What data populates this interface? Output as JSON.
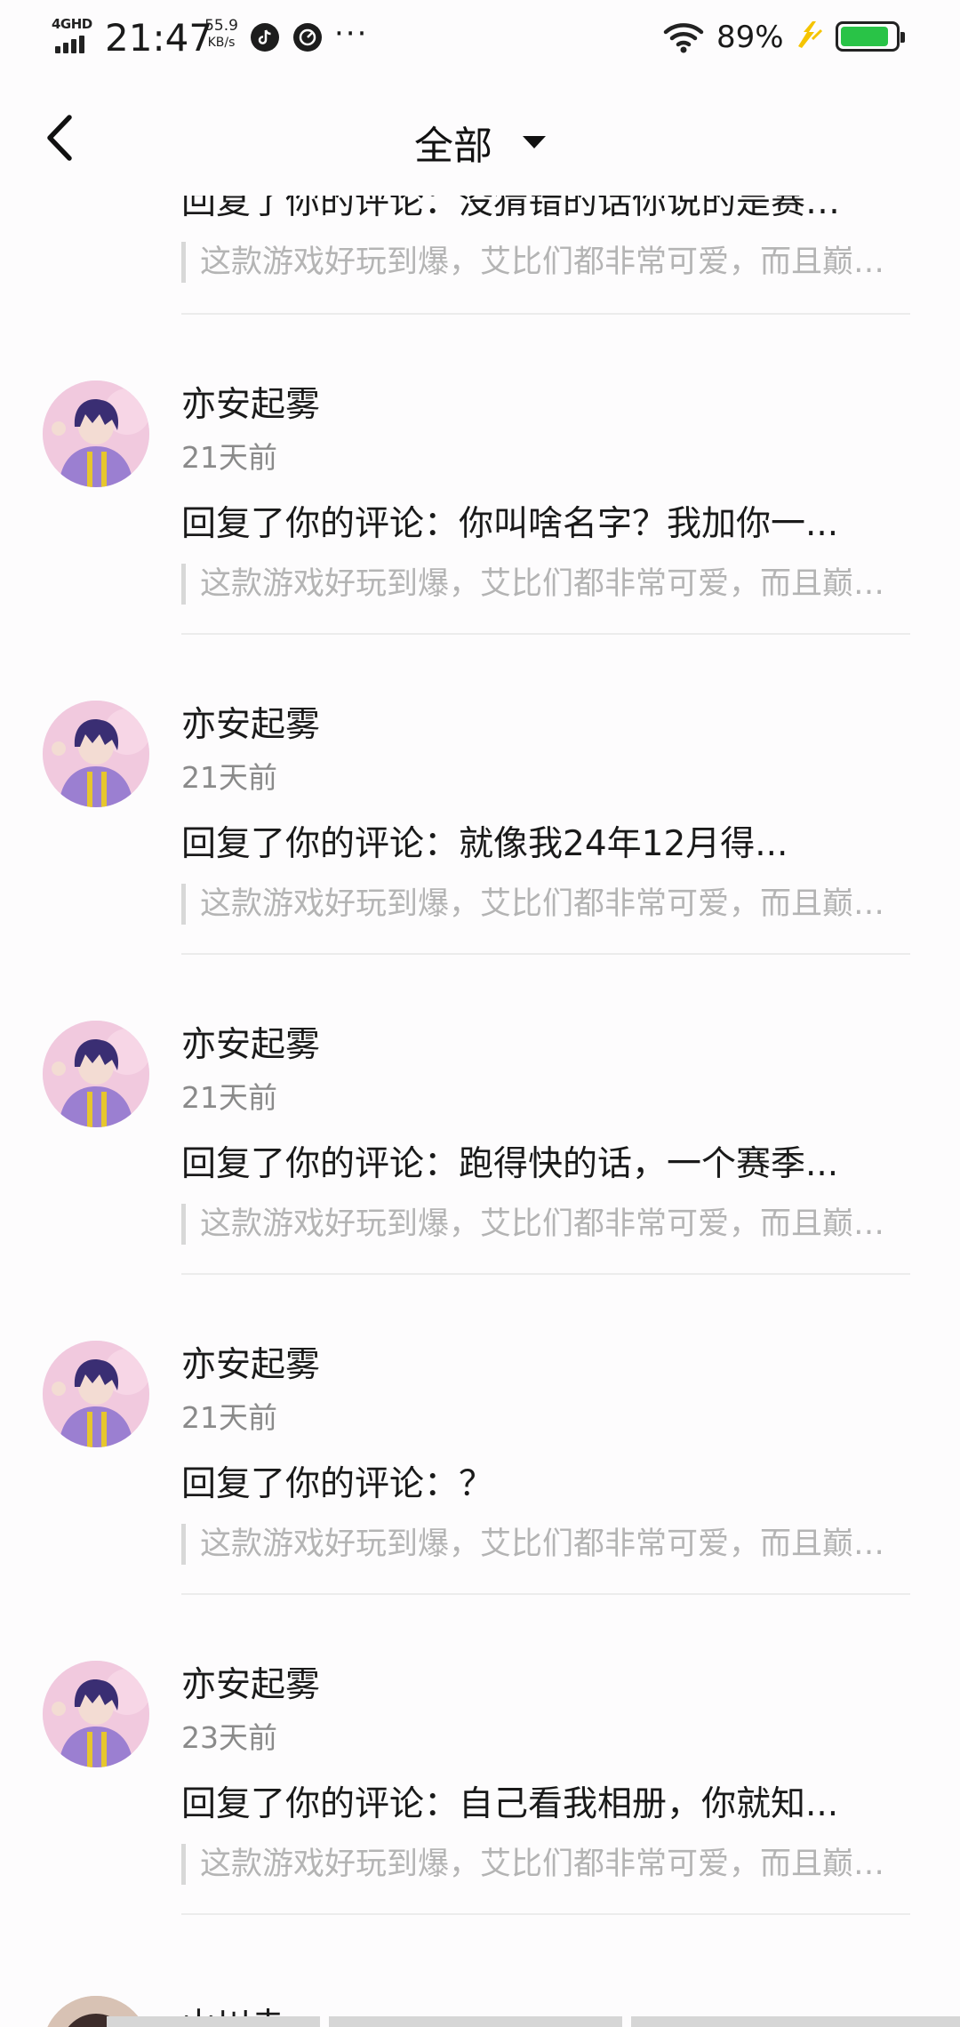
{
  "status_bar": {
    "network": "4GHD",
    "time": "21:47",
    "speed_value": "55.9",
    "speed_unit": "KB/s",
    "more": "···",
    "battery_pct": "89%",
    "battery_level": 0.89,
    "colors": {
      "battery_fill": "#29c347",
      "bolt": "#f5c400"
    }
  },
  "nav": {
    "back_icon": "chevron-left-icon",
    "title": "全部",
    "dropdown_icon": "caret-down-icon"
  },
  "partial_top": {
    "reply": "回复了你的评论：没猜错的话你说的是赛…",
    "quote": "这款游戏好玩到爆，艾比们都非常可爱，而且巅…"
  },
  "items": [
    {
      "username": "亦安起雾",
      "time": "21天前",
      "reply": "回复了你的评论：你叫啥名字？我加你一...",
      "quote": "这款游戏好玩到爆，艾比们都非常可爱，而且巅…"
    },
    {
      "username": "亦安起雾",
      "time": "21天前",
      "reply": "回复了你的评论：就像我24年12月得...",
      "quote": "这款游戏好玩到爆，艾比们都非常可爱，而且巅…"
    },
    {
      "username": "亦安起雾",
      "time": "21天前",
      "reply": "回复了你的评论：跑得快的话，一个赛季...",
      "quote": "这款游戏好玩到爆，艾比们都非常可爱，而且巅…"
    },
    {
      "username": "亦安起雾",
      "time": "21天前",
      "reply": "回复了你的评论：？",
      "quote": "这款游戏好玩到爆，艾比们都非常可爱，而且巅…"
    },
    {
      "username": "亦安起雾",
      "time": "23天前",
      "reply": "回复了你的评论：自己看我相册，你就知...",
      "quote": "这款游戏好玩到爆，艾比们都非常可爱，而且巅…"
    }
  ],
  "partial_bottom": {
    "username": "山川赤"
  }
}
